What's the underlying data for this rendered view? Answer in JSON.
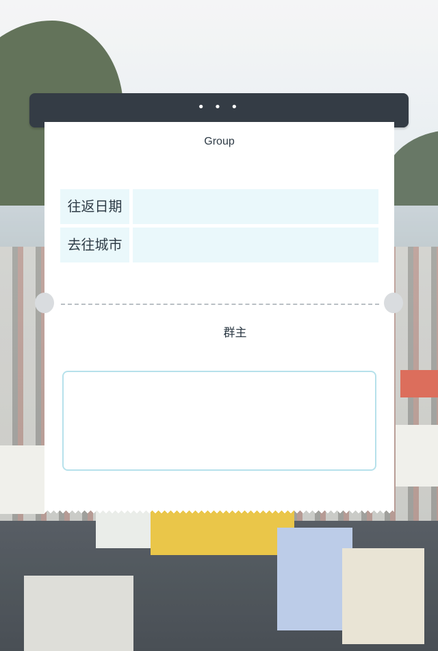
{
  "form": {
    "title": "Group",
    "more_dots": "• • •",
    "fields": [
      {
        "label": "往返日期",
        "value": ""
      },
      {
        "label": "去往城市",
        "value": ""
      }
    ],
    "owner_label": "群主",
    "notes_value": ""
  },
  "colors": {
    "topbar": "#343c45",
    "field_bg": "#eaf8fb",
    "textarea_border": "#b6e1eb",
    "text": "#2e3b46"
  }
}
